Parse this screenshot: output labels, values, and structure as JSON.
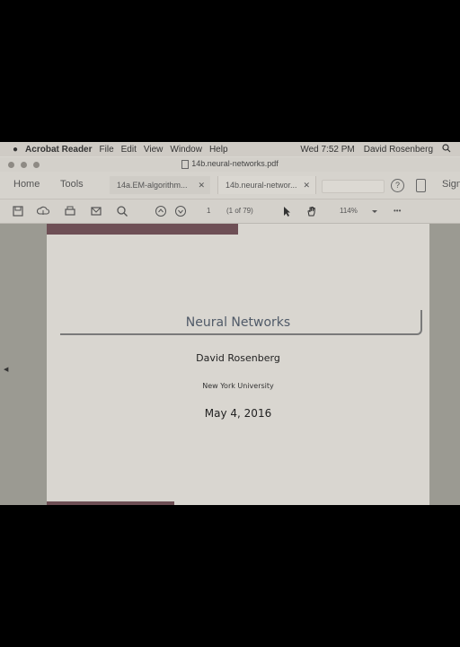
{
  "menubar": {
    "app_name": "Acrobat Reader",
    "items": [
      "File",
      "Edit",
      "View",
      "Window",
      "Help"
    ],
    "clock": "Wed 7:52 PM",
    "user": "David Rosenberg"
  },
  "window": {
    "title": "14b.neural-networks.pdf"
  },
  "nav": {
    "home": "Home",
    "tools": "Tools",
    "sign": "Sign"
  },
  "tabs": [
    {
      "label": "14a.EM-algorithm..."
    },
    {
      "label": "14b.neural-networ..."
    }
  ],
  "toolbar": {
    "page_number": "1",
    "page_count": "(1 of 79)",
    "zoom": "114%",
    "more": "•••"
  },
  "slide": {
    "title": "Neural Networks",
    "author": "David Rosenberg",
    "institution": "New York University",
    "date": "May 4, 2016"
  }
}
